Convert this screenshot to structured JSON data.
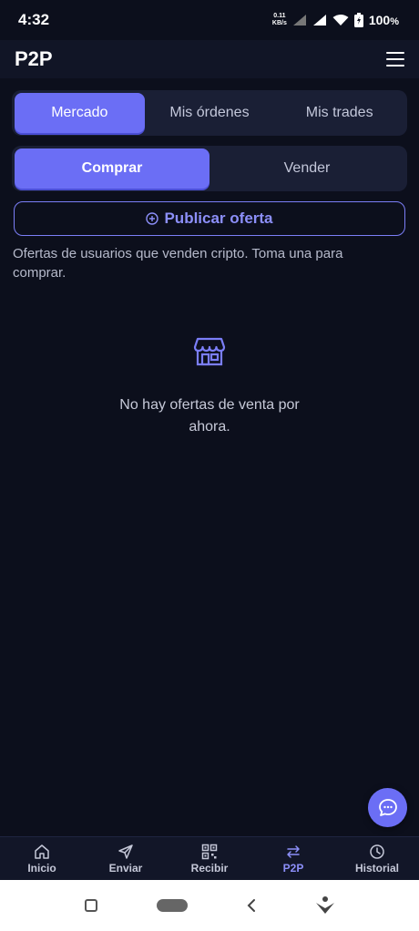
{
  "status": {
    "time": "4:32",
    "net_speed_top": "0.11",
    "net_speed_bottom": "KB/s",
    "battery": "100",
    "battery_unit": "%"
  },
  "appbar": {
    "title": "P2P",
    "menu_icon": "hamburger-icon"
  },
  "tabs": [
    {
      "label": "Mercado",
      "active": true
    },
    {
      "label": "Mis órdenes",
      "active": false
    },
    {
      "label": "Mis trades",
      "active": false
    }
  ],
  "mode": [
    {
      "label": "Comprar",
      "active": true
    },
    {
      "label": "Vender",
      "active": false
    }
  ],
  "publish_label": "Publicar oferta",
  "description": "Ofertas de usuarios que venden cripto. Toma una para comprar.",
  "empty": {
    "icon": "store-icon",
    "text": "No hay ofertas de venta por ahora."
  },
  "fab_icon": "chat-icon",
  "nav": [
    {
      "label": "Inicio",
      "icon": "home-icon"
    },
    {
      "label": "Enviar",
      "icon": "send-icon"
    },
    {
      "label": "Recibir",
      "icon": "qr-icon"
    },
    {
      "label": "P2P",
      "icon": "swap-icon",
      "active": true
    },
    {
      "label": "Historial",
      "icon": "clock-icon"
    }
  ],
  "colors": {
    "accent": "#6b6ef5",
    "background": "#0c0f1c",
    "surface": "#1a1f35"
  }
}
